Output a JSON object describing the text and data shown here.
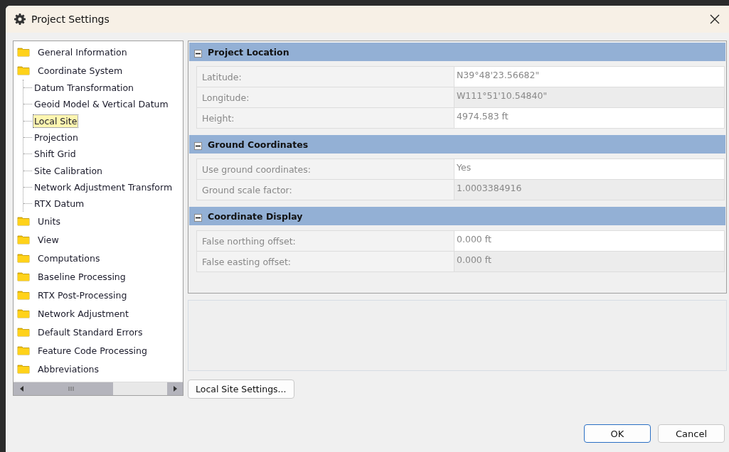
{
  "window": {
    "title": "Project Settings"
  },
  "tree": [
    {
      "label": "General Information",
      "selected": false
    },
    {
      "label": "Coordinate System",
      "selected": false,
      "children": [
        {
          "label": "Datum Transformation",
          "selected": false
        },
        {
          "label": "Geoid Model & Vertical Datum",
          "selected": false
        },
        {
          "label": "Local Site",
          "selected": true
        },
        {
          "label": "Projection",
          "selected": false
        },
        {
          "label": "Shift Grid",
          "selected": false
        },
        {
          "label": "Site Calibration",
          "selected": false
        },
        {
          "label": "Network Adjustment Transform",
          "selected": false
        },
        {
          "label": "RTX Datum",
          "selected": false
        }
      ]
    },
    {
      "label": "Units",
      "selected": false
    },
    {
      "label": "View",
      "selected": false
    },
    {
      "label": "Computations",
      "selected": false
    },
    {
      "label": "Baseline Processing",
      "selected": false
    },
    {
      "label": "RTX Post-Processing",
      "selected": false
    },
    {
      "label": "Network Adjustment",
      "selected": false
    },
    {
      "label": "Default Standard Errors",
      "selected": false
    },
    {
      "label": "Feature Code Processing",
      "selected": false
    },
    {
      "label": "Abbreviations",
      "selected": false
    }
  ],
  "sections": [
    {
      "title": "Project Location",
      "expanded": true,
      "rows": [
        {
          "label": "Latitude:",
          "value": "N39°48'23.56682\""
        },
        {
          "label": "Longitude:",
          "value": "W111°51'10.54840\""
        },
        {
          "label": "Height:",
          "value": "4974.583 ft"
        }
      ]
    },
    {
      "title": "Ground Coordinates",
      "expanded": true,
      "rows": [
        {
          "label": "Use ground coordinates:",
          "value": "Yes"
        },
        {
          "label": "Ground scale factor:",
          "value": "1.0003384916"
        }
      ]
    },
    {
      "title": "Coordinate Display",
      "expanded": true,
      "rows": [
        {
          "label": "False northing offset:",
          "value": "0.000 ft"
        },
        {
          "label": "False easting offset:",
          "value": "0.000 ft"
        }
      ]
    }
  ],
  "action_button": "Local Site Settings...",
  "buttons": [
    {
      "label": "OK",
      "default": true
    },
    {
      "label": "Cancel",
      "default": false
    }
  ]
}
